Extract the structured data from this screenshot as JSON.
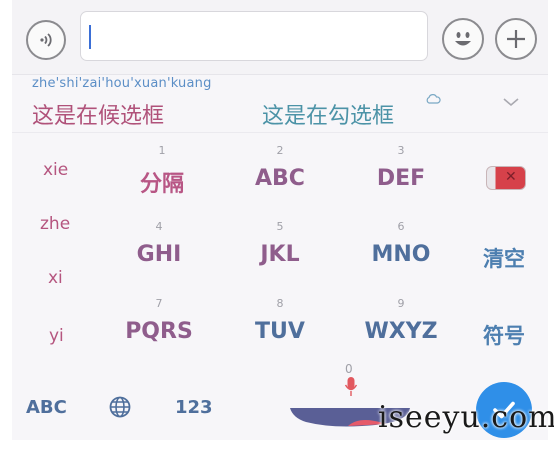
{
  "input": {
    "value": ""
  },
  "candidates": {
    "pinyin": "zhe'shi'zai'hou'xuan'kuang",
    "items": [
      "这是在候选框",
      "这是在勾选框"
    ]
  },
  "syllables": [
    "xie",
    "zhe",
    "xi",
    "yi"
  ],
  "keys": [
    {
      "num": "1",
      "label": "分隔"
    },
    {
      "num": "2",
      "label": "ABC"
    },
    {
      "num": "3",
      "label": "DEF"
    },
    {
      "num": "4",
      "label": "GHI"
    },
    {
      "num": "5",
      "label": "JKL"
    },
    {
      "num": "6",
      "label": "MNO"
    },
    {
      "num": "7",
      "label": "PQRS"
    },
    {
      "num": "8",
      "label": "TUV"
    },
    {
      "num": "9",
      "label": "WXYZ"
    }
  ],
  "side": {
    "clear": "清空",
    "symbol": "符号"
  },
  "bottom": {
    "abc": "ABC",
    "num": "123",
    "space_num": "0"
  },
  "watermark": "iseeyu.com",
  "colors": {
    "accent": "#2f8fe8",
    "candidate_primary": "#b0527a",
    "candidate_secondary": "#4c93a7",
    "delete": "#d6414a"
  },
  "icons": [
    "voice-icon",
    "emoji-icon",
    "plus-icon",
    "cloud-icon",
    "chevron-down-icon",
    "backspace-icon",
    "globe-icon",
    "mic-icon",
    "checkmark-icon"
  ]
}
